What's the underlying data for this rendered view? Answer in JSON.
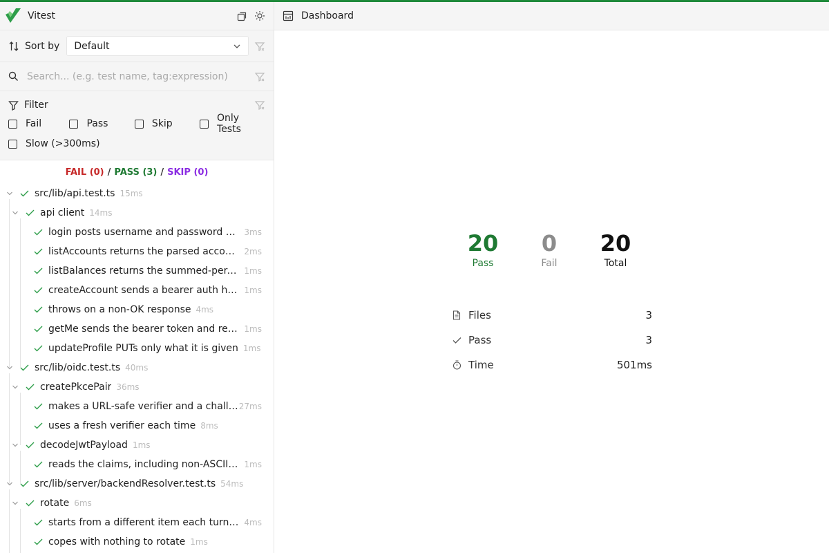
{
  "app": {
    "title": "Vitest"
  },
  "colors": {
    "accent": "#1f8a3b",
    "fail": "#c62828",
    "pass": "#1f7a33",
    "skip": "#8a2be2"
  },
  "sort": {
    "label": "Sort by",
    "value": "Default"
  },
  "search": {
    "placeholder": "Search... (e.g. test name, tag:expression)"
  },
  "filter": {
    "title": "Filter",
    "options": [
      {
        "label": "Fail",
        "checked": false
      },
      {
        "label": "Pass",
        "checked": false
      },
      {
        "label": "Skip",
        "checked": false
      },
      {
        "label": "Only Tests",
        "checked": false
      },
      {
        "label": "Slow (>300ms)",
        "checked": false
      }
    ]
  },
  "summary": {
    "fail": "FAIL (0)",
    "pass": "PASS (3)",
    "skip": "SKIP (0)",
    "sep": "/"
  },
  "tree": [
    {
      "kind": "file",
      "name": "src/lib/api.test.ts",
      "duration": "15ms"
    },
    {
      "kind": "suite",
      "name": "api client",
      "duration": "14ms"
    },
    {
      "kind": "test",
      "name": "login posts username and password and ...",
      "duration": "3ms"
    },
    {
      "kind": "test",
      "name": "listAccounts returns the parsed account ...",
      "duration": "2ms"
    },
    {
      "kind": "test",
      "name": "listBalances returns the summed-per-na...",
      "duration": "1ms"
    },
    {
      "kind": "test",
      "name": "createAccount sends a bearer auth head...",
      "duration": "1ms"
    },
    {
      "kind": "test",
      "name": "throws on a non-OK response",
      "duration": "4ms"
    },
    {
      "kind": "test",
      "name": "getMe sends the bearer token and retur...",
      "duration": "1ms"
    },
    {
      "kind": "test",
      "name": "updateProfile PUTs only what it is given",
      "duration": "1ms"
    },
    {
      "kind": "file",
      "name": "src/lib/oidc.test.ts",
      "duration": "40ms"
    },
    {
      "kind": "suite",
      "name": "createPkcePair",
      "duration": "36ms"
    },
    {
      "kind": "test",
      "name": "makes a URL-safe verifier and a challen...",
      "duration": "27ms"
    },
    {
      "kind": "test",
      "name": "uses a fresh verifier each time",
      "duration": "8ms"
    },
    {
      "kind": "suite",
      "name": "decodeJwtPayload",
      "duration": "1ms"
    },
    {
      "kind": "test",
      "name": "reads the claims, including non-ASCII on...",
      "duration": "1ms"
    },
    {
      "kind": "file",
      "name": "src/lib/server/backendResolver.test.ts",
      "duration": "54ms"
    },
    {
      "kind": "suite",
      "name": "rotate",
      "duration": "6ms"
    },
    {
      "kind": "test",
      "name": "starts from a different item each turn an...",
      "duration": "4ms"
    },
    {
      "kind": "test",
      "name": "copes with nothing to rotate",
      "duration": "1ms"
    }
  ],
  "dashboard": {
    "title": "Dashboard",
    "stats": [
      {
        "value": "20",
        "label": "Pass"
      },
      {
        "value": "0",
        "label": "Fail"
      },
      {
        "value": "20",
        "label": "Total"
      }
    ],
    "details": [
      {
        "icon": "file-icon",
        "label": "Files",
        "value": "3"
      },
      {
        "icon": "check-icon",
        "label": "Pass",
        "value": "3"
      },
      {
        "icon": "timer-icon",
        "label": "Time",
        "value": "501ms"
      }
    ]
  }
}
